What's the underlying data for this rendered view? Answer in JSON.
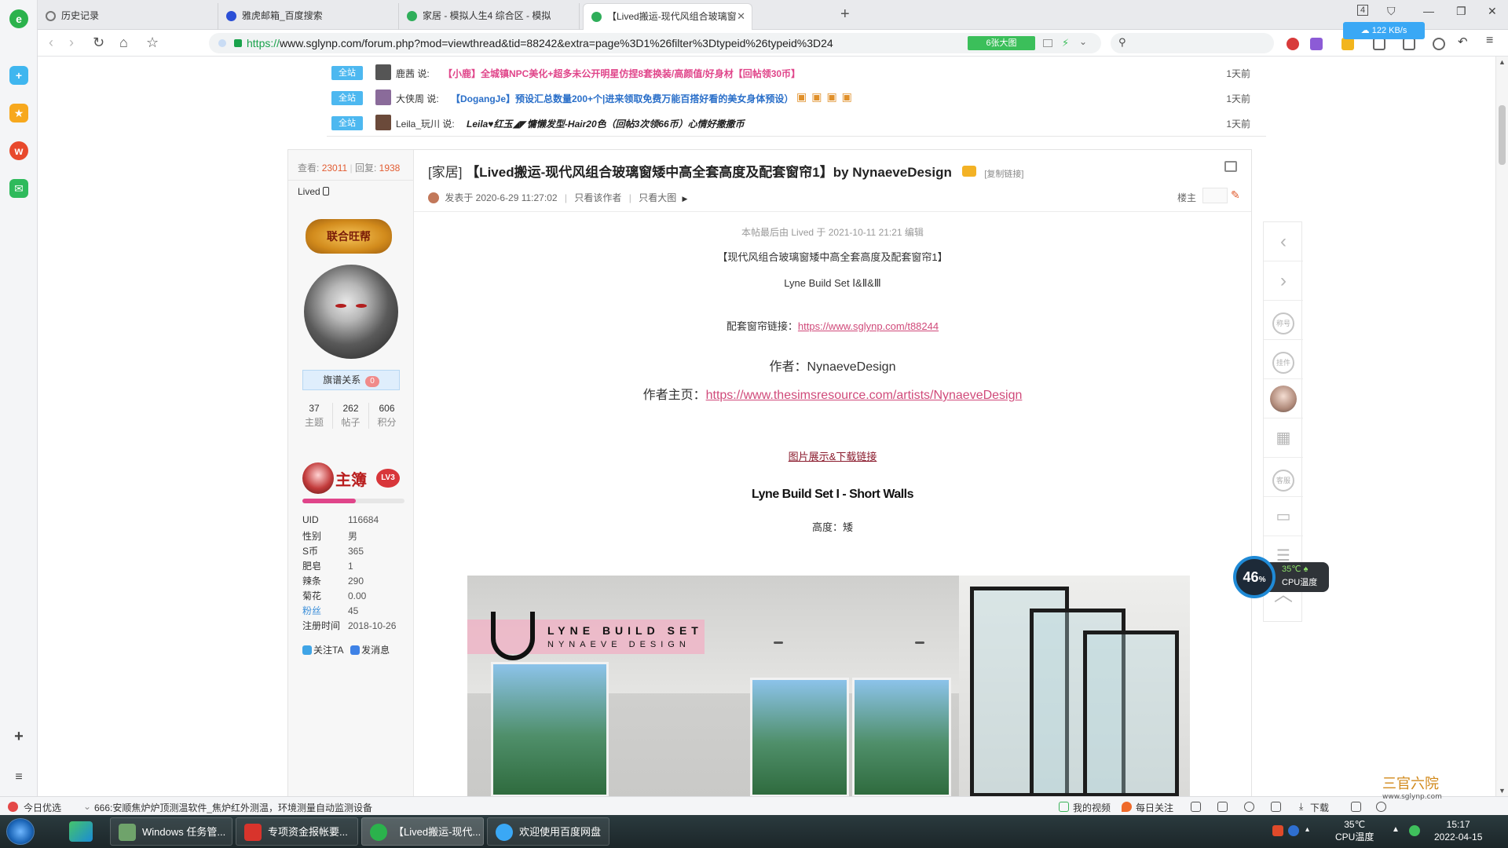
{
  "tabs": [
    {
      "label": "历史记录",
      "active": false
    },
    {
      "label": "雅虎邮箱_百度搜索",
      "active": false
    },
    {
      "label": "家居 - 模拟人生4 综合区 - 模拟",
      "active": false
    },
    {
      "label": "【Lived搬运-现代风组合玻璃窗",
      "active": true
    }
  ],
  "window": {
    "tab_count": "4"
  },
  "toolbar": {
    "url_scheme": "https://",
    "url_rest": "www.sglynp.com/forum.php?mod=viewthread&tid=88242&extra=page%3D1%26filter%3Dtypeid%26typeid%3D24",
    "bigimg_label": "6张大图",
    "speed": "122 KB/s"
  },
  "announcements": [
    {
      "badge": "全站",
      "user": "鹿茜 说:",
      "text": "【小鹿】全城镇NPC美化+超多未公开明星仿捏8套换装/高颜值/好身材【回帖领30币】",
      "color": "#e0458a",
      "time": "1天前"
    },
    {
      "badge": "全站",
      "user": "大侠周 说:",
      "text": "【DogangJe】预设汇总数量200+个|进来领取免费万能百搭好看的美女身体预设）",
      "color": "#2a6fc9",
      "time": "1天前"
    },
    {
      "badge": "全站",
      "user": "Leila_玩川 说:",
      "text": "Leila♥红玉◢◤慵懒发型-Hair20色（回帖3次领66币）心情好撒撒币",
      "color": "#222222",
      "time": "1天前"
    }
  ],
  "thread": {
    "views_label": "查看:",
    "views": "23011",
    "replies_label": "回复:",
    "replies": "1938",
    "category": "[家居]",
    "title": "【Lived搬运-现代风组合玻璃窗矮中高全套高度及配套窗帘1】by NynaeveDesign",
    "copy_link": "[复制链接]",
    "posted": "发表于 2020-6-29 11:27:02",
    "only_author": "只看该作者",
    "big_image": "只看大图",
    "floor": "楼主",
    "edit_note": "本帖最后由 Lived 于 2021-10-11 21:21 编辑",
    "heading": "【现代风组合玻璃窗矮中高全套高度及配套窗帘1】",
    "set_line": "Lyne Build Set Ⅰ&Ⅱ&Ⅲ",
    "curtain_label": "配套窗帘链接：",
    "curtain_url": "https://www.sglynp.com/t88244",
    "author_line": "作者：NynaeveDesign",
    "home_label": "作者主页：",
    "home_url": "https://www.thesimsresource.com/artists/NynaeveDesign",
    "download_link": "图片展示&下载链接",
    "set_title": "Lyne Build Set I - Short Walls",
    "height_line": "高度：矮",
    "preview_logo_1": "LYNE BUILD SET",
    "preview_logo_2": "NYNAEVE DESIGN"
  },
  "author": {
    "name": "Lived",
    "guild_badge": "联合旺帮",
    "relation_label": "旗谱关系",
    "relation_count": "0",
    "counts": [
      {
        "n": "37",
        "l": "主题"
      },
      {
        "n": "262",
        "l": "帖子"
      },
      {
        "n": "606",
        "l": "积分"
      }
    ],
    "rank_title": "主簿",
    "rank_level": "LV3",
    "rank_progress": 0.52,
    "fields": [
      {
        "k": "UID",
        "v": "116684",
        "link": false
      },
      {
        "k": "性别",
        "v": "男",
        "link": false
      },
      {
        "k": "S币",
        "v": "365",
        "link": false
      },
      {
        "k": "肥皂",
        "v": "1",
        "link": false
      },
      {
        "k": "辣条",
        "v": "290",
        "link": false
      },
      {
        "k": "菊花",
        "v": "0.00",
        "link": false
      },
      {
        "k": "粉丝",
        "v": "45",
        "link": true
      },
      {
        "k": "注册时间",
        "v": "2018-10-26",
        "link": false
      }
    ],
    "follow": "关注TA",
    "message": "发消息"
  },
  "float_bar": {
    "badge1": "称号",
    "badge2": "挂件",
    "kefu": "客服"
  },
  "cpu": {
    "percent": "46",
    "unit": "%",
    "temp": "35℃",
    "label": "CPU温度"
  },
  "statusbar": {
    "today": "今日优选",
    "news": "666:安顺焦炉炉顶测温软件_焦炉红外测温，环境测量自动监测设备",
    "video": "我的视频",
    "follow": "每日关注",
    "download": "下载"
  },
  "taskbar": {
    "tasks": [
      {
        "label": "Windows 任务管..."
      },
      {
        "label": "专项资金报帐要..."
      },
      {
        "label": "【Lived搬运-现代..."
      },
      {
        "label": "欢迎使用百度网盘"
      }
    ],
    "temp": "35℃",
    "temp_label": "CPU温度",
    "time": "15:17",
    "date": "2022-04-15"
  },
  "watermark": {
    "text": "三官六院",
    "url": "www.sglynp.com"
  }
}
